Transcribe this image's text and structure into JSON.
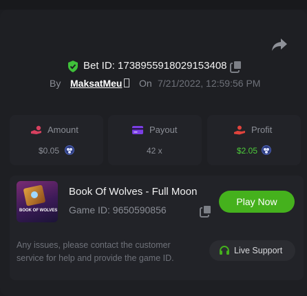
{
  "bet": {
    "id_text": "Bet ID: 1738955918029153408",
    "by_label": "By",
    "username": "MaksatMeu",
    "on_label": "On",
    "datetime": "7/21/2022, 12:59:56 PM"
  },
  "stats": {
    "amount": {
      "label": "Amount",
      "value": "$0.05"
    },
    "payout": {
      "label": "Payout",
      "value": "42 x"
    },
    "profit": {
      "label": "Profit",
      "value": "$2.05"
    }
  },
  "game": {
    "name": "Book Of Wolves - Full Moon",
    "id_text": "Game ID: 9650590856",
    "thumb_title": "BOOK OF WOLVES FULL MOON",
    "play_label": "Play Now"
  },
  "support": {
    "help_text": "Any issues, please contact the customer service for help and provide the game ID.",
    "live_label": "Live Support"
  },
  "colors": {
    "background": "#1e1f23",
    "card": "#222328",
    "accent_green": "#45b11d",
    "profit_green": "#4ecb3b",
    "amount_icon": "#d8405f",
    "payout_icon": "#7b3fe4",
    "profit_icon": "#e0433c",
    "muted_text": "#8b8e96"
  },
  "icons": {
    "share": "share-arrow-icon",
    "verified": "shield-check-icon",
    "copy": "copy-icon",
    "amount": "hand-coin-icon",
    "payout": "card-icon",
    "profit": "person-hand-icon",
    "currency": "coin-icon",
    "support": "headset-icon"
  }
}
